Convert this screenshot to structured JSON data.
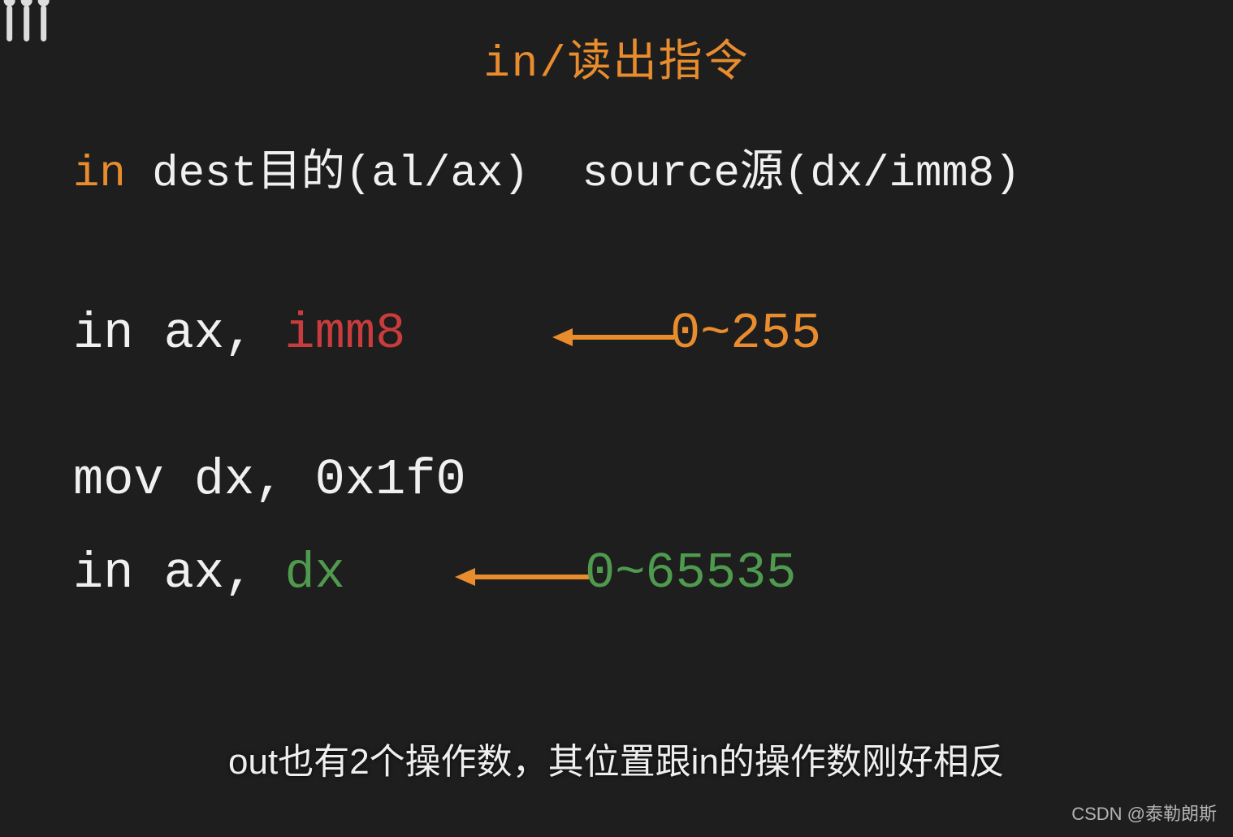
{
  "title": "in/读出指令",
  "syntax": {
    "keyword": "in",
    "rest": " dest目的(al/ax)  source源(dx/imm8)"
  },
  "example1": {
    "prefix": "in ax, ",
    "operand": "imm8",
    "range": "0~255"
  },
  "mov_line": "mov dx, 0x1f0",
  "example2": {
    "prefix": "in ax, ",
    "operand": "dx",
    "range": "0~65535"
  },
  "subtitle": "out也有2个操作数，其位置跟in的操作数刚好相反",
  "watermark_csdn": "CSDN @泰勒朗斯",
  "colors": {
    "orange": "#e88c2e",
    "red": "#c83c3c",
    "green": "#4f9a4f",
    "bg": "#1e1e1e",
    "text": "#f0f0f0"
  },
  "logo_name": "bilibili-logo"
}
